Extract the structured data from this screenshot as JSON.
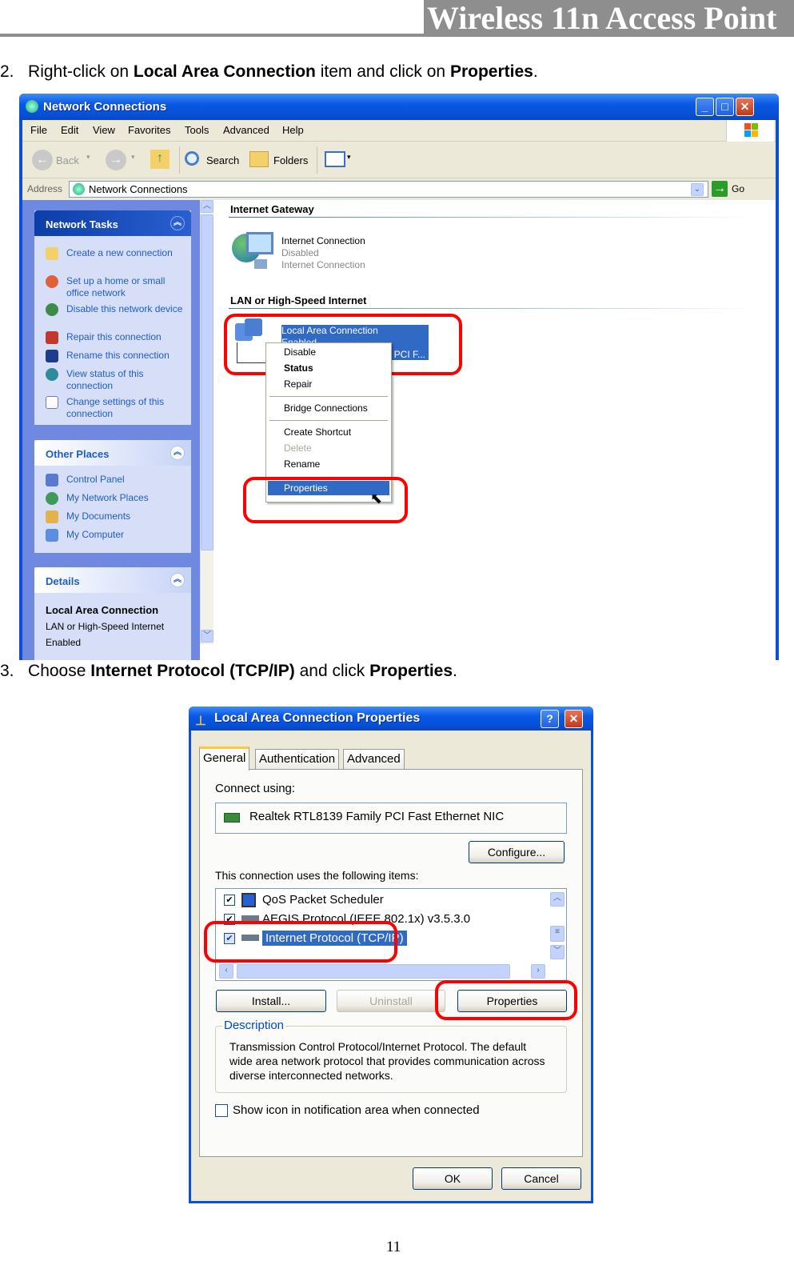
{
  "header": {
    "title": "Wireless 11n Access Point"
  },
  "steps": [
    {
      "number": "2.",
      "pre": "Right-click on ",
      "bold1": "Local Area Connection",
      "mid": " item and click on ",
      "bold2": "Properties",
      "post": "."
    },
    {
      "number": "3.",
      "pre": "Choose ",
      "bold1": "Internet Protocol (TCP/IP)",
      "mid": " and click ",
      "bold2": "Properties",
      "post": "."
    }
  ],
  "network_window": {
    "title": "Network Connections",
    "menu": [
      "File",
      "Edit",
      "View",
      "Favorites",
      "Tools",
      "Advanced",
      "Help"
    ],
    "toolbar": {
      "back": "Back",
      "search": "Search",
      "folders": "Folders"
    },
    "address": {
      "label": "Address",
      "value": "Network Connections",
      "go": "Go"
    },
    "network_tasks": {
      "title": "Network Tasks",
      "items": [
        "Create a new connection",
        "Set up a home or small office network",
        "Disable this network device",
        "Repair this connection",
        "Rename this connection",
        "View status of this connection",
        "Change settings of this connection"
      ]
    },
    "other_places": {
      "title": "Other Places",
      "items": [
        "Control Panel",
        "My Network Places",
        "My Documents",
        "My Computer"
      ]
    },
    "details": {
      "title": "Details",
      "name": "Local Area Connection",
      "type": "LAN or High-Speed Internet",
      "status": "Enabled"
    },
    "groups": [
      {
        "title": "Internet Gateway",
        "item": {
          "name": "Internet Connection",
          "status": "Disabled",
          "type": "Internet Connection"
        }
      },
      {
        "title": "LAN or High-Speed Internet",
        "item": {
          "name": "Local Area Connection",
          "status": "Enabled",
          "device": "PCI F..."
        }
      }
    ],
    "context_menu": [
      "Disable",
      "Status",
      "Repair",
      "Bridge Connections",
      "Create Shortcut",
      "Delete",
      "Rename",
      "Properties"
    ]
  },
  "dialog": {
    "title": "Local Area Connection Properties",
    "tabs": [
      "General",
      "Authentication",
      "Advanced"
    ],
    "connect_using_label": "Connect using:",
    "adapter": "Realtek RTL8139 Family PCI Fast Ethernet NIC",
    "configure_button": "Configure...",
    "items_label": "This connection uses the following items:",
    "items": [
      {
        "label": "QoS Packet Scheduler",
        "checked": true
      },
      {
        "label": "AEGIS Protocol (IEEE 802.1x) v3.5.3.0",
        "checked": true
      },
      {
        "label": "Internet Protocol (TCP/IP)",
        "checked": true,
        "selected": true
      }
    ],
    "buttons": {
      "install": "Install...",
      "uninstall": "Uninstall",
      "properties": "Properties",
      "ok": "OK",
      "cancel": "Cancel"
    },
    "description_label": "Description",
    "description": "Transmission Control Protocol/Internet Protocol. The default wide area network protocol that provides communication across diverse interconnected networks.",
    "show_icon_label": "Show icon in notification area when connected"
  },
  "footer": {
    "page_number": "11"
  }
}
